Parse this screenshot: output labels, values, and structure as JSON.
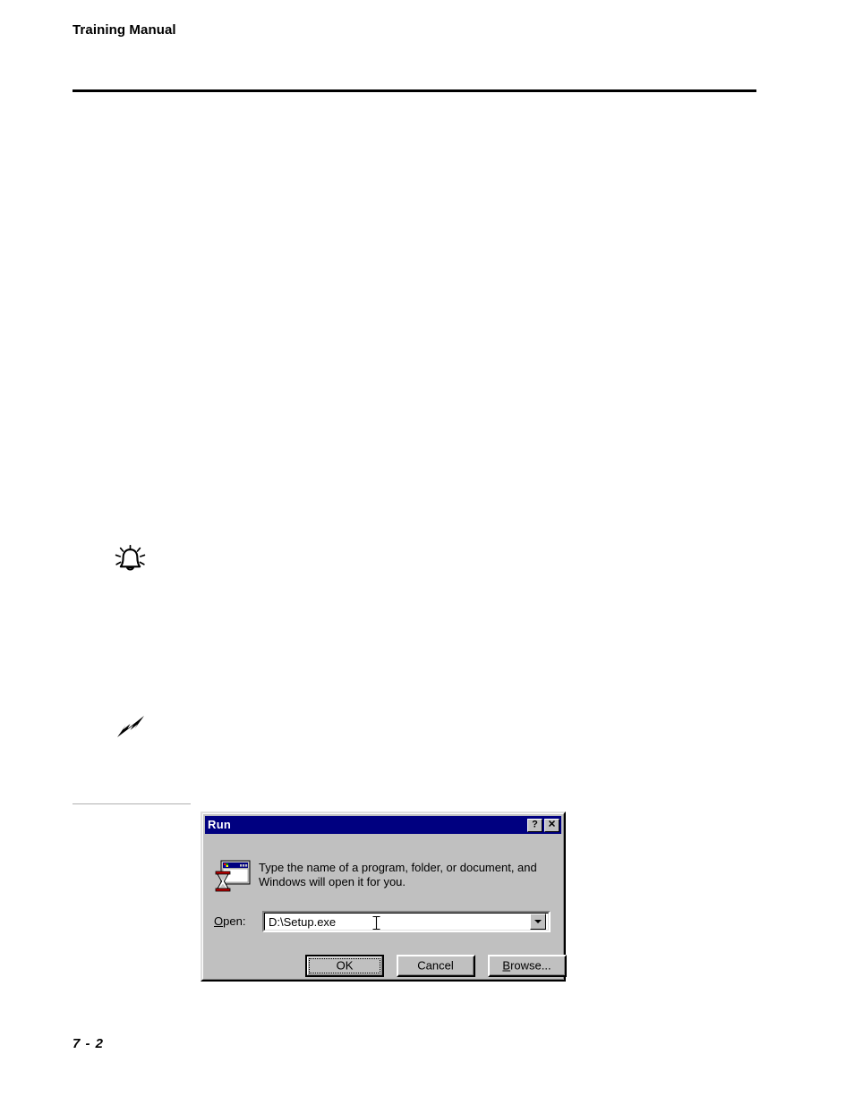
{
  "page": {
    "header_title": "Training Manual",
    "page_number": "7 - 2",
    "markers": [
      {
        "name": "bell-note-icon",
        "kind": "bell"
      },
      {
        "name": "lightning-caution-icon",
        "kind": "bolt"
      }
    ]
  },
  "dialog": {
    "title": "Run",
    "titlebar_buttons": [
      {
        "name": "help-button",
        "glyph": "?"
      },
      {
        "name": "close-button",
        "glyph": "✕"
      }
    ],
    "icon_name": "run-window-hourglass-icon",
    "message": "Type the name of a program, folder, or document, and Windows will open it for you.",
    "open_field": {
      "label_prefix": "O",
      "label_suffix": "pen:",
      "label_full": "Open:",
      "value": "D:\\Setup.exe",
      "placeholder": "",
      "dropdown_icon": "chevron-down-icon"
    },
    "buttons": [
      {
        "name": "ok-button",
        "prefix": "",
        "accel": "",
        "suffix": "OK",
        "label": "OK",
        "default": true
      },
      {
        "name": "cancel-button",
        "prefix": "",
        "accel": "",
        "suffix": "Cancel",
        "label": "Cancel",
        "default": false
      },
      {
        "name": "browse-button",
        "prefix": "",
        "accel": "B",
        "suffix": "rowse...",
        "label": "Browse...",
        "default": false
      }
    ],
    "colors": {
      "titlebar": "#000080",
      "face": "#c0c0c0",
      "field": "#ffffff",
      "text": "#000000"
    }
  }
}
